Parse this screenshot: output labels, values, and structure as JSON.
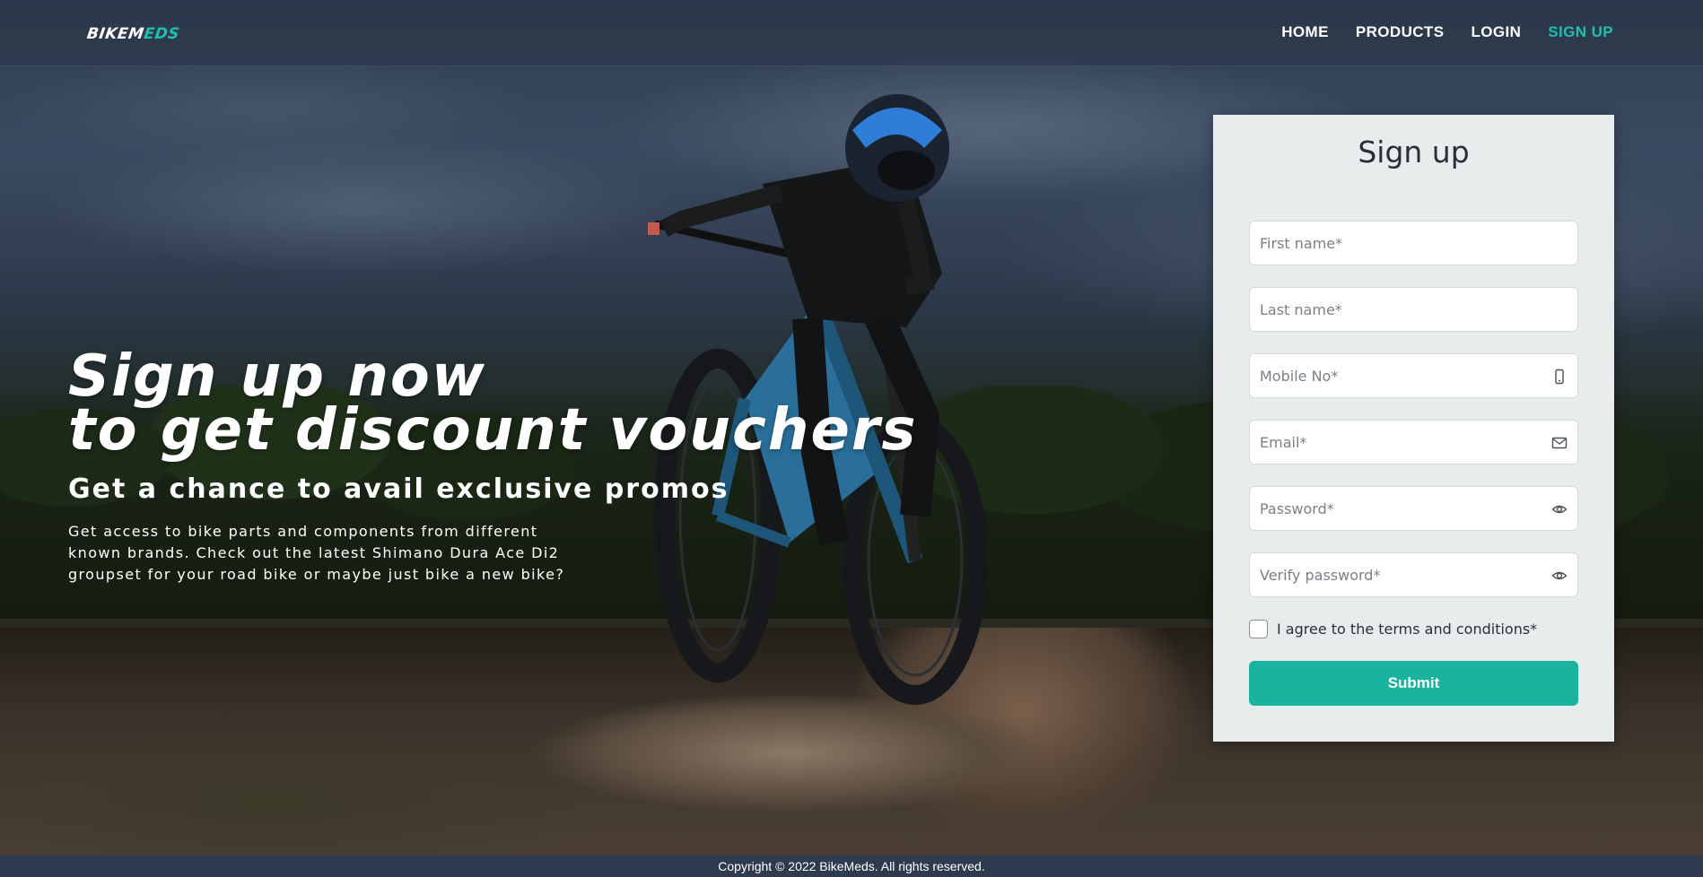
{
  "brand": {
    "logo_main": "BIKEM",
    "logo_accent": "EDS",
    "accent_color": "#1fbfae"
  },
  "nav": {
    "items": [
      {
        "label": "HOME",
        "active": false
      },
      {
        "label": "PRODUCTS",
        "active": false
      },
      {
        "label": "LOGIN",
        "active": false
      },
      {
        "label": "SIGN UP",
        "active": true
      }
    ]
  },
  "hero": {
    "headline_line1": "Sign up now",
    "headline_line2": "to get discount vouchers",
    "subhead": "Get a chance to avail exclusive promos",
    "body": "Get access to bike parts and components from different known brands. Check out the latest Shimano Dura Ace Di2 groupset for your road bike or maybe just bike a new bike?"
  },
  "form": {
    "title": "Sign up",
    "fields": {
      "first_name": {
        "placeholder": "First name*",
        "value": ""
      },
      "last_name": {
        "placeholder": "Last name*",
        "value": ""
      },
      "mobile": {
        "placeholder": "Mobile No*",
        "value": "",
        "icon": "phone-icon"
      },
      "email": {
        "placeholder": "Email*",
        "value": "",
        "icon": "mail-icon"
      },
      "password": {
        "placeholder": "Password*",
        "value": "",
        "icon": "eye-icon"
      },
      "verify_password": {
        "placeholder": "Verify password*",
        "value": "",
        "icon": "eye-icon"
      }
    },
    "agree_label": "I agree to the terms and conditions*",
    "agree_checked": false,
    "submit_label": "Submit",
    "submit_color": "#1ab3a0"
  },
  "footer": {
    "copyright": "Copyright © 2022 BikeMeds. All rights reserved."
  }
}
